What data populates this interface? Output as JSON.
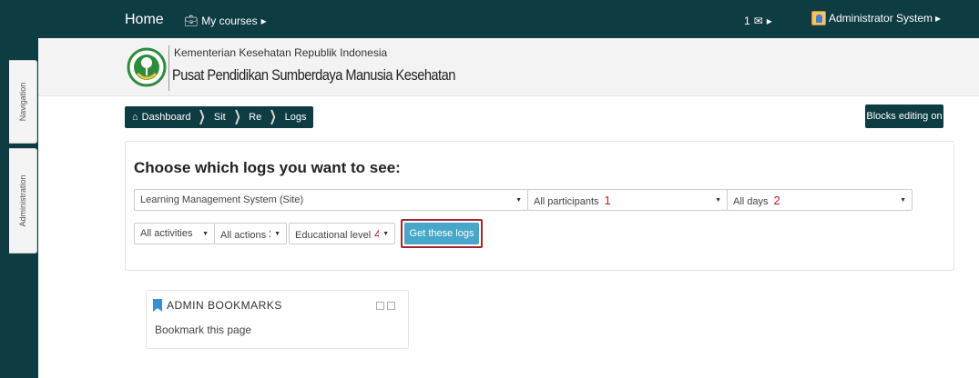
{
  "navbar": {
    "home": "Home",
    "my_courses": "My courses",
    "messages_count": "1",
    "user_name": "Administrator System"
  },
  "header": {
    "org_line1": "Kementerian Kesehatan Republik Indonesia",
    "org_line2": "Pusat Pendidikan Sumberdaya Manusia Kesehatan"
  },
  "side_tabs": {
    "navigation": "Navigation",
    "administration": "Administration"
  },
  "breadcrumb": {
    "items": [
      "Dashboard",
      "Sit",
      "Re",
      "Logs"
    ]
  },
  "blocks_editing_label": "Blocks editing on",
  "logs": {
    "title": "Choose which logs you want to see:",
    "site_select": "Learning Management System (Site)",
    "participants_select": "All participants",
    "participants_marker": "1",
    "days_select": "All days",
    "days_marker": "2",
    "activities_select": "All activities",
    "actions_select": "All actions",
    "actions_marker": "3",
    "edu_select": "Educational level",
    "edu_marker": "4",
    "get_logs_button": "Get these logs"
  },
  "bookmarks": {
    "title": "ADMIN BOOKMARKS",
    "link": "Bookmark this page"
  },
  "colors": {
    "brand_dark": "#0e3c43",
    "button_blue": "#46a7c9",
    "highlight_red": "#a8232c",
    "marker_red": "#c0181f"
  }
}
